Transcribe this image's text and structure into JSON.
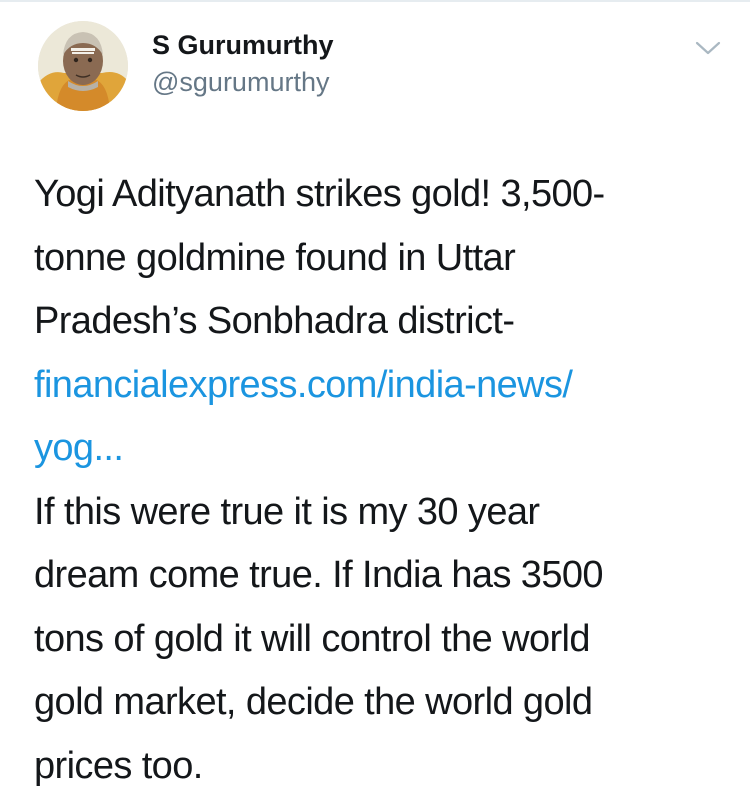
{
  "colors": {
    "text": "#14171a",
    "secondary": "#657786",
    "link": "#1b95e0",
    "divider": "#e6ecf0"
  },
  "author": {
    "display_name": "S Gurumurthy",
    "handle": "@sgurumurthy",
    "avatar_icon": "avatar-portrait-icon"
  },
  "menu": {
    "icon": "chevron-down-icon"
  },
  "tweet": {
    "headline_lines": [
      "Yogi Adityanath strikes gold! 3,500-",
      "tonne goldmine found in Uttar",
      "Pradesh’s Sonbhadra district-"
    ],
    "link_lines": [
      "financialexpress.com/india-news/",
      "yog..."
    ],
    "comment_lines": [
      "If this were true it is my 30 year",
      "dream come true. If India has 3500",
      "tons of gold it will control the world",
      "gold market, decide the world gold",
      "prices too."
    ]
  }
}
